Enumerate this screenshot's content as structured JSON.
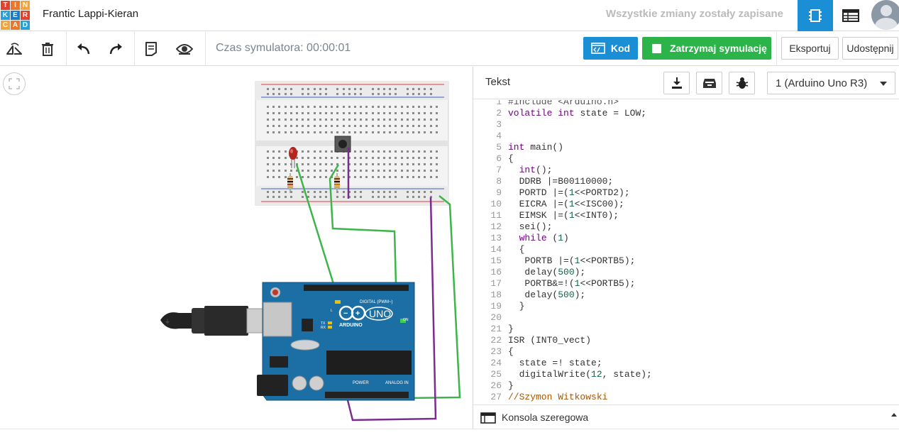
{
  "logo": {
    "letters": [
      "T",
      "I",
      "N",
      "K",
      "E",
      "R",
      "C",
      "A",
      "D"
    ],
    "colors": [
      "#e2412f",
      "#e9782c",
      "#f3a33b",
      "#2aa1d6",
      "#1a7cc4",
      "#e2412f",
      "#f3a33b",
      "#e9782c",
      "#2aa1d6"
    ]
  },
  "header": {
    "project_title": "Frantic Lappi-Kieran",
    "save_status": "Wszystkie zmiany zostały zapisane"
  },
  "toolbar": {
    "sim_time": "Czas symulatora: 00:00:01",
    "code_label": "Kod",
    "stop_label": "Zatrzymaj symulację",
    "export_label": "Eksportuj",
    "share_label": "Udostępnij"
  },
  "panel": {
    "mode_label": "Tekst",
    "device": "1 (Arduino Uno R3)",
    "console_label": "Konsola szeregowa"
  },
  "circuit_labels": {
    "digital": "DIGITAL (PWM~)",
    "arduino": "ARDUINO",
    "uno": "UNO",
    "power": "POWER",
    "analog": "ANALOG IN",
    "on": "ON",
    "l": "L",
    "tx": "TX",
    "rx": "RX"
  },
  "code_lines": [
    "#include <Arduino.h>",
    "volatile int state = LOW;",
    "",
    "",
    "int main()",
    "{",
    "  int();",
    "  DDRB |=B00110000;",
    "  PORTD |=(1<<PORTD2);",
    "  EICRA |=(1<<ISC00);",
    "  EIMSK |=(1<<INT0);",
    "  sei();",
    "  while (1)",
    "  {",
    "   PORTB |=(1<<PORTB5);",
    "   delay(500);",
    "   PORTB&=!(1<<PORTB5);",
    "   delay(500);",
    "  }",
    "",
    "}",
    "ISR (INT0_vect)",
    "{",
    "  state =! state;",
    "  digitalWrite(12, state);",
    "}",
    "//Szymon Witkowski"
  ],
  "colors": {
    "accent_blue": "#1a8fd6",
    "sim_green": "#2cb34a",
    "wire_green": "#3db54a",
    "wire_purple": "#7b2d8e",
    "arduino_blue": "#1c6fa5"
  }
}
